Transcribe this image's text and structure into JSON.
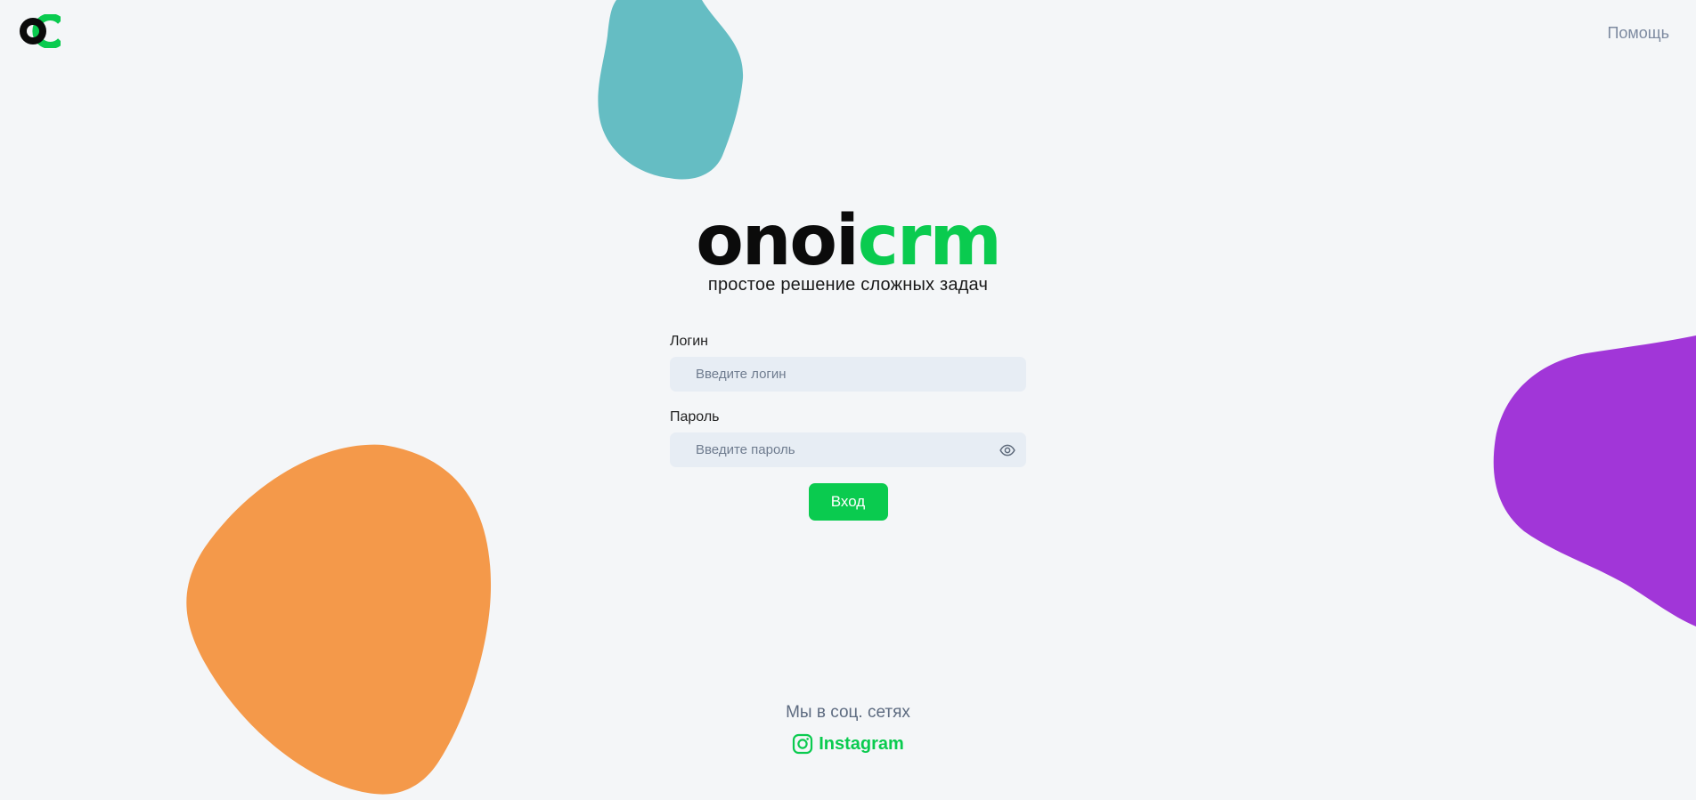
{
  "header": {
    "help_label": "Помощь"
  },
  "brand": {
    "name_dark": "onoi",
    "name_green": "crm",
    "tagline": "простое решение сложных задач"
  },
  "login_form": {
    "login_label": "Логин",
    "login_placeholder": "Введите логин",
    "password_label": "Пароль",
    "password_placeholder": "Введите пароль",
    "submit_label": "Вход"
  },
  "social": {
    "title": "Мы в соц. сетях",
    "instagram_label": "Instagram"
  },
  "icons": {
    "logo": "logo-mark-icon",
    "eye": "eye-icon",
    "instagram": "instagram-icon"
  },
  "colors": {
    "background": "#f4f6f8",
    "accent_green": "#0acb4f",
    "brand_dark": "#0b0b0b",
    "input_bg": "#e7edf4",
    "blob_teal": "#65bdc3",
    "blob_orange": "#f4994a",
    "blob_purple": "#a136d8"
  }
}
